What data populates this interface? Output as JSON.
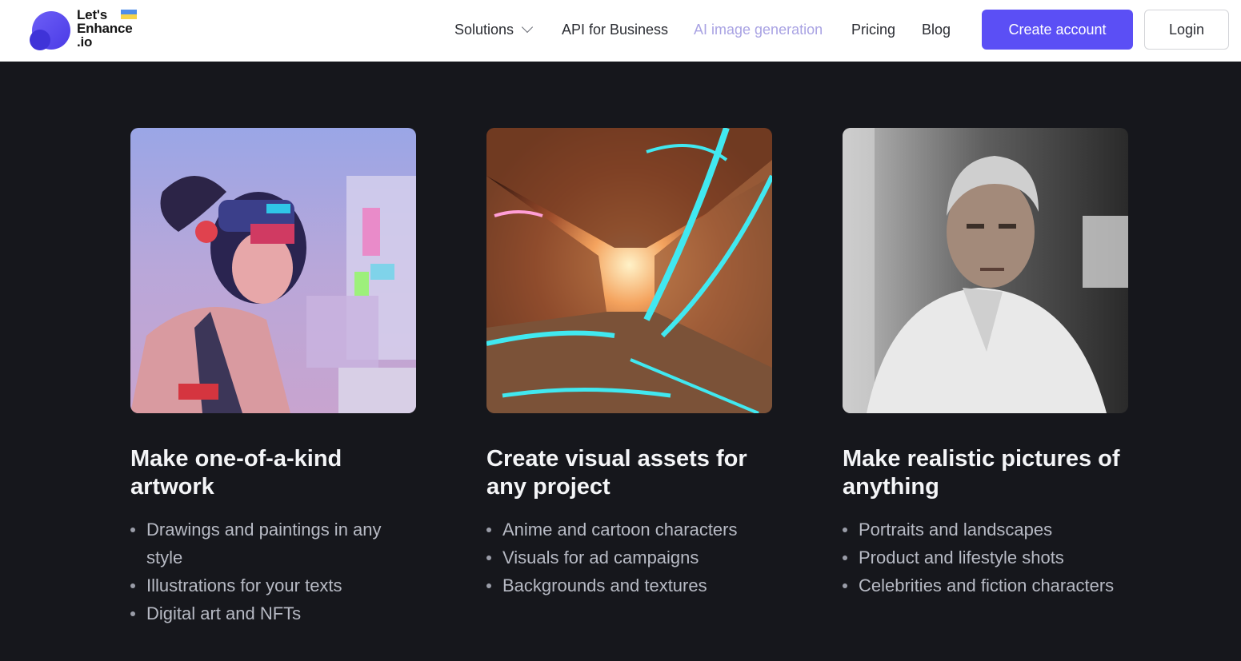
{
  "brand": {
    "line1": "Let's",
    "line2": "Enhance",
    "line3": ".io"
  },
  "nav": {
    "solutions": "Solutions",
    "api": "API for Business",
    "ai_image": "AI image generation",
    "pricing": "Pricing",
    "blog": "Blog",
    "create_account": "Create account",
    "login": "Login"
  },
  "colors": {
    "accent": "#5b4ff5",
    "background": "#16171c",
    "active_nav": "#a9a3e3"
  },
  "cards": [
    {
      "image": "cyberpunk-girl-artwork",
      "title": "Make one-of-a-kind artwork",
      "items": [
        "Drawings and paintings in any style",
        "Illustrations for your texts",
        "Digital art and NFTs"
      ]
    },
    {
      "image": "neon-canyon-tunnel",
      "title": "Create visual assets for any project",
      "items": [
        "Anime and cartoon characters",
        "Visuals for ad campaigns",
        "Backgrounds and textures"
      ]
    },
    {
      "image": "realistic-portrait-man",
      "title": "Make realistic pictures of anything",
      "items": [
        "Portraits and landscapes",
        "Product and lifestyle shots",
        "Celebrities and fiction characters"
      ]
    }
  ]
}
